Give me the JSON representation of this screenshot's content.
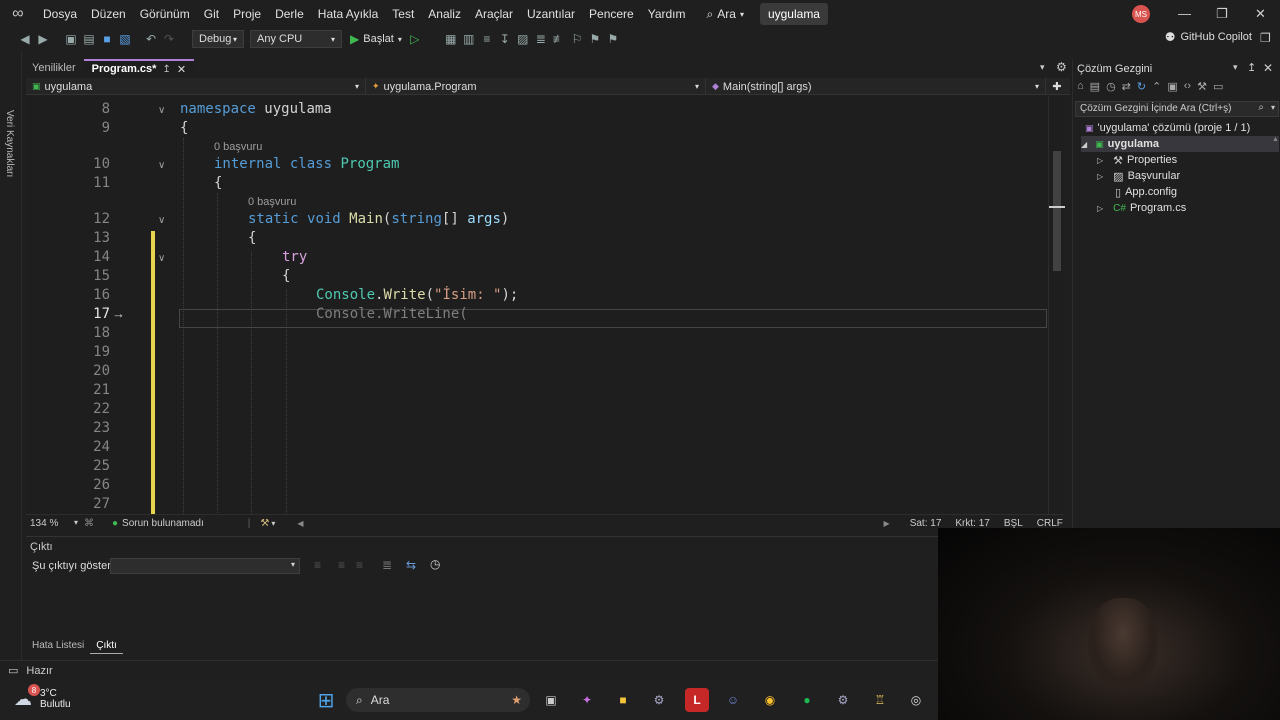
{
  "menu": {
    "items": [
      "Dosya",
      "Düzen",
      "Görünüm",
      "Git",
      "Proje",
      "Derle",
      "Hata Ayıkla",
      "Test",
      "Analiz",
      "Araçlar",
      "Uzantılar",
      "Pencere",
      "Yardım"
    ],
    "search_label": "Ara",
    "solution_name": "uygulama",
    "avatar_initials": "MS"
  },
  "toolbar": {
    "config": "Debug",
    "platform": "Any CPU",
    "start_label": "Başlat",
    "copilot_label": "GitHub Copilot"
  },
  "left_strip": {
    "label": "Veri Kaynakları"
  },
  "tabs": [
    {
      "label": "Yenilikler",
      "active": false
    },
    {
      "label": "Program.cs*",
      "active": true
    }
  ],
  "navbar": {
    "project": "uygulama",
    "type": "uygulama.Program",
    "member": "Main(string[] args)"
  },
  "editor": {
    "line_numbers": [
      "8",
      "9",
      "10",
      "11",
      "12",
      "13",
      "14",
      "15",
      "16",
      "17",
      "18",
      "19",
      "20",
      "21",
      "22",
      "23",
      "24",
      "25",
      "26",
      "27"
    ],
    "current_line": "17",
    "references_hint": "0 başvuru",
    "code": {
      "l8_kw": "namespace",
      "l8_name": "uygulama",
      "brace_open": "{",
      "l10_kw1": "internal",
      "l10_kw2": "class",
      "l10_name": "Program",
      "l12_kw1": "static",
      "l12_kw2": "void",
      "l12_fn": "Main",
      "l12_p1": "(",
      "l12_type": "string",
      "l12_p2": "[] ",
      "l12_arg": "args",
      "l12_p3": ")",
      "l14_kw": "try",
      "l16_cls": "Console",
      "l16_dot": ".",
      "l16_fn": "Write",
      "l16_open": "(",
      "l16_str": "\"İsim: \"",
      "l16_close": ");",
      "l17_ghost": "Console.WriteLine("
    }
  },
  "editor_status": {
    "zoom": "134 %",
    "issues": "Sorun bulunamadı",
    "line": "Sat: 17",
    "col": "Krkt: 17",
    "mode": "BŞL",
    "eol": "CRLF"
  },
  "output": {
    "title": "Çıktı",
    "show_label": "Şu çıktıyı göster:"
  },
  "bottom_tabs": [
    "Hata Listesi",
    "Çıktı"
  ],
  "solution_explorer": {
    "title": "Çözüm Gezgini",
    "search_placeholder": "Çözüm Gezgini İçinde Ara (Ctrl+ş)",
    "solution_label": "'uygulama' çözümü (proje 1 / 1)",
    "project": "uygulama",
    "items": [
      "Properties",
      "Başvurular",
      "App.config",
      "Program.cs"
    ]
  },
  "status_bar": {
    "text": "Hazır"
  },
  "taskbar": {
    "weather_temp": "3°C",
    "weather_desc": "Bulutlu",
    "notification_count": "8",
    "search_label": "Ara"
  },
  "colors": {
    "accent": "#b180d7",
    "keyword": "#569cd6",
    "type": "#4ec9b0",
    "function": "#dcdcaa",
    "string": "#d69d85"
  }
}
